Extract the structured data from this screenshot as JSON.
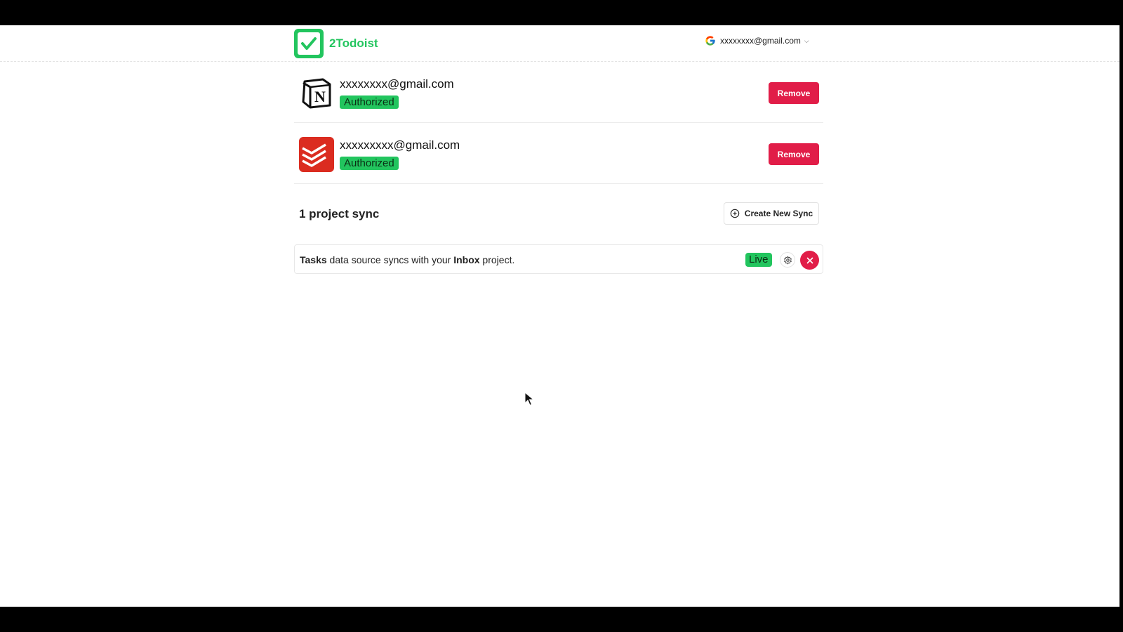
{
  "app": {
    "name": "2Todoist",
    "brand_color": "#22c55e"
  },
  "header": {
    "account_email": "xxxxxxxx@gmail.com",
    "account_provider_icon": "google-icon",
    "dropdown_icon": "chevron-down-icon"
  },
  "accounts": [
    {
      "service_icon": "notion-icon",
      "email": "xxxxxxxx@gmail.com",
      "status": "Authorized",
      "action_label": "Remove"
    },
    {
      "service_icon": "todoist-icon",
      "email": "xxxxxxxxx@gmail.com",
      "status": "Authorized",
      "action_label": "Remove"
    }
  ],
  "syncs": {
    "title": "1 project sync",
    "create_label": "Create New Sync",
    "items": [
      {
        "source": "Tasks",
        "text_middle": " data source syncs with your ",
        "project": "Inbox",
        "text_end": " project.",
        "status": "Live"
      }
    ]
  },
  "colors": {
    "danger": "#e11d48",
    "success": "#22c55e"
  }
}
